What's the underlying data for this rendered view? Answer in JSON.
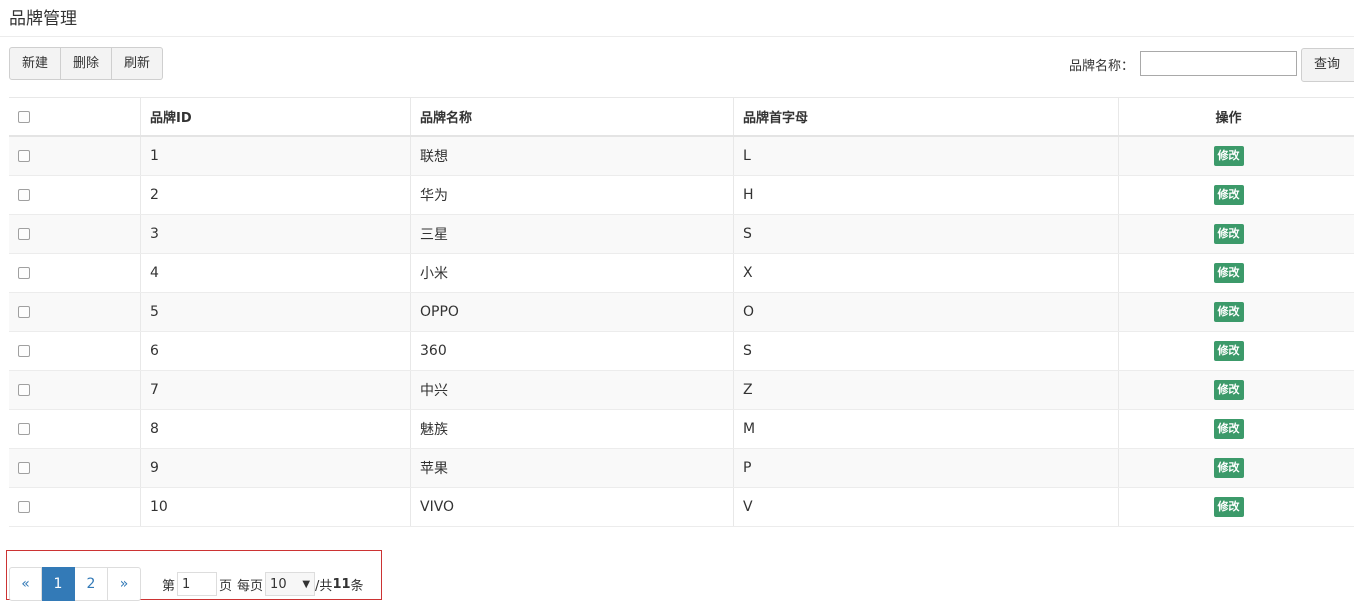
{
  "page_title": "品牌管理",
  "toolbar": {
    "new_label": "新建",
    "delete_label": "删除",
    "refresh_label": "刷新"
  },
  "search": {
    "label": "品牌名称：",
    "value": "",
    "button_label": "查询"
  },
  "table": {
    "headers": {
      "id": "品牌ID",
      "name": "品牌名称",
      "initial": "品牌首字母",
      "action": "操作"
    },
    "edit_label": "修改",
    "rows": [
      {
        "id": "1",
        "name": "联想",
        "initial": "L"
      },
      {
        "id": "2",
        "name": "华为",
        "initial": "H"
      },
      {
        "id": "3",
        "name": "三星",
        "initial": "S"
      },
      {
        "id": "4",
        "name": "小米",
        "initial": "X"
      },
      {
        "id": "5",
        "name": "OPPO",
        "initial": "O"
      },
      {
        "id": "6",
        "name": "360",
        "initial": "S"
      },
      {
        "id": "7",
        "name": "中兴",
        "initial": "Z"
      },
      {
        "id": "8",
        "name": "魅族",
        "initial": "M"
      },
      {
        "id": "9",
        "name": "苹果",
        "initial": "P"
      },
      {
        "id": "10",
        "name": "VIVO",
        "initial": "V"
      }
    ]
  },
  "pagination": {
    "prev": "«",
    "pages": [
      "1",
      "2"
    ],
    "next": "»",
    "current_page": "1",
    "label_page_prefix": "第",
    "label_page_suffix": "页",
    "label_per_page": "每页",
    "page_size": "10",
    "label_total_prefix": "/共",
    "total": "11",
    "label_total_suffix": "条"
  },
  "colors": {
    "edit_button": "#3c9a6a",
    "active_page": "#337ab7",
    "highlight_box": "#cc3333"
  }
}
